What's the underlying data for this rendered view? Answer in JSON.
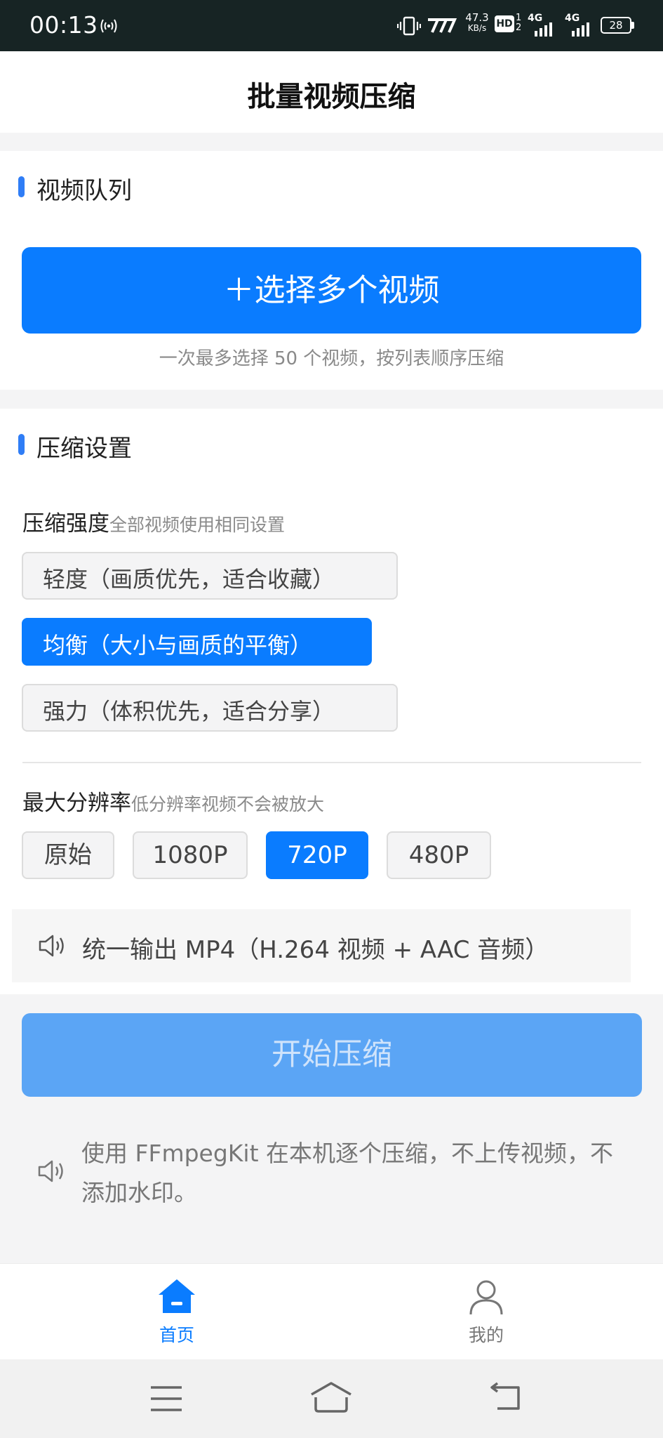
{
  "status_bar": {
    "time": "00:13",
    "speed_value": "47.3",
    "speed_unit": "KB/s",
    "signal_1": "4G",
    "signal_2": "4G",
    "battery": "28",
    "network_label": "HD",
    "sim_1": "1",
    "sim_2": "2"
  },
  "header": {
    "title": "批量视频压缩"
  },
  "queue": {
    "section_title": "视频队列",
    "select_button": "＋选择多个视频",
    "hint": "一次最多选择 50 个视频，按列表顺序压缩"
  },
  "settings": {
    "section_title": "压缩设置",
    "strength_label": "压缩强度",
    "strength_hint": "全部视频使用相同设置",
    "strength_options": [
      {
        "label": "轻度（画质优先，适合收藏）",
        "selected": false
      },
      {
        "label": "均衡（大小与画质的平衡）",
        "selected": true
      },
      {
        "label": "强力（体积优先，适合分享）",
        "selected": false
      }
    ],
    "resolution_label": "最大分辨率",
    "resolution_hint": "低分辨率视频不会被放大",
    "resolution_options": [
      {
        "label": "原始",
        "selected": false
      },
      {
        "label": "1080P",
        "selected": false
      },
      {
        "label": "720P",
        "selected": true
      },
      {
        "label": "480P",
        "selected": false
      }
    ],
    "output_notice": "统一输出 MP4（H.264 视频 + AAC 音频）"
  },
  "start_button": "开始压缩",
  "footnote": "使用 FFmpegKit 在本机逐个压缩，不上传视频，不添加水印。",
  "tabs": [
    {
      "label": "首页",
      "icon": "home-icon",
      "active": true
    },
    {
      "label": "我的",
      "icon": "user-icon",
      "active": false
    }
  ],
  "colors": {
    "accent": "#0a7cff",
    "accent_disabled": "#5ba5f5",
    "section_bar": "#2f7df6",
    "status_bar": "#172424"
  },
  "icons": [
    "vibrate-icon",
    "speaker-icon",
    "home-icon",
    "user-icon",
    "menu-icon",
    "nav-home-icon",
    "back-icon"
  ]
}
